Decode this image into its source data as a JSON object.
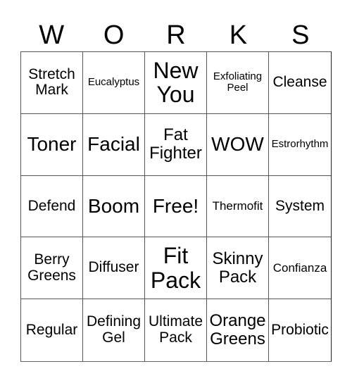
{
  "header": {
    "letters": [
      "W",
      "O",
      "R",
      "K",
      "S"
    ]
  },
  "grid": {
    "rows": [
      [
        "Stretch\nMark",
        "Eucalyptus",
        "New\nYou",
        "Exfoliating\nPeel",
        "Cleanse"
      ],
      [
        "Toner",
        "Facial",
        "Fat\nFighter",
        "WOW",
        "Estrorhythm"
      ],
      [
        "Defend",
        "Boom",
        "Free!",
        "Thermofit",
        "System"
      ],
      [
        "Berry\nGreens",
        "Diffuser",
        "Fit\nPack",
        "Skinny\nPack",
        "Confianza"
      ],
      [
        "Regular",
        "Defining\nGel",
        "Ultimate\nPack",
        "Orange\nGreens",
        "Probiotic"
      ]
    ]
  },
  "colors": {
    "text": "#000000",
    "background": "#ffffff",
    "grid_line": "#555555"
  }
}
